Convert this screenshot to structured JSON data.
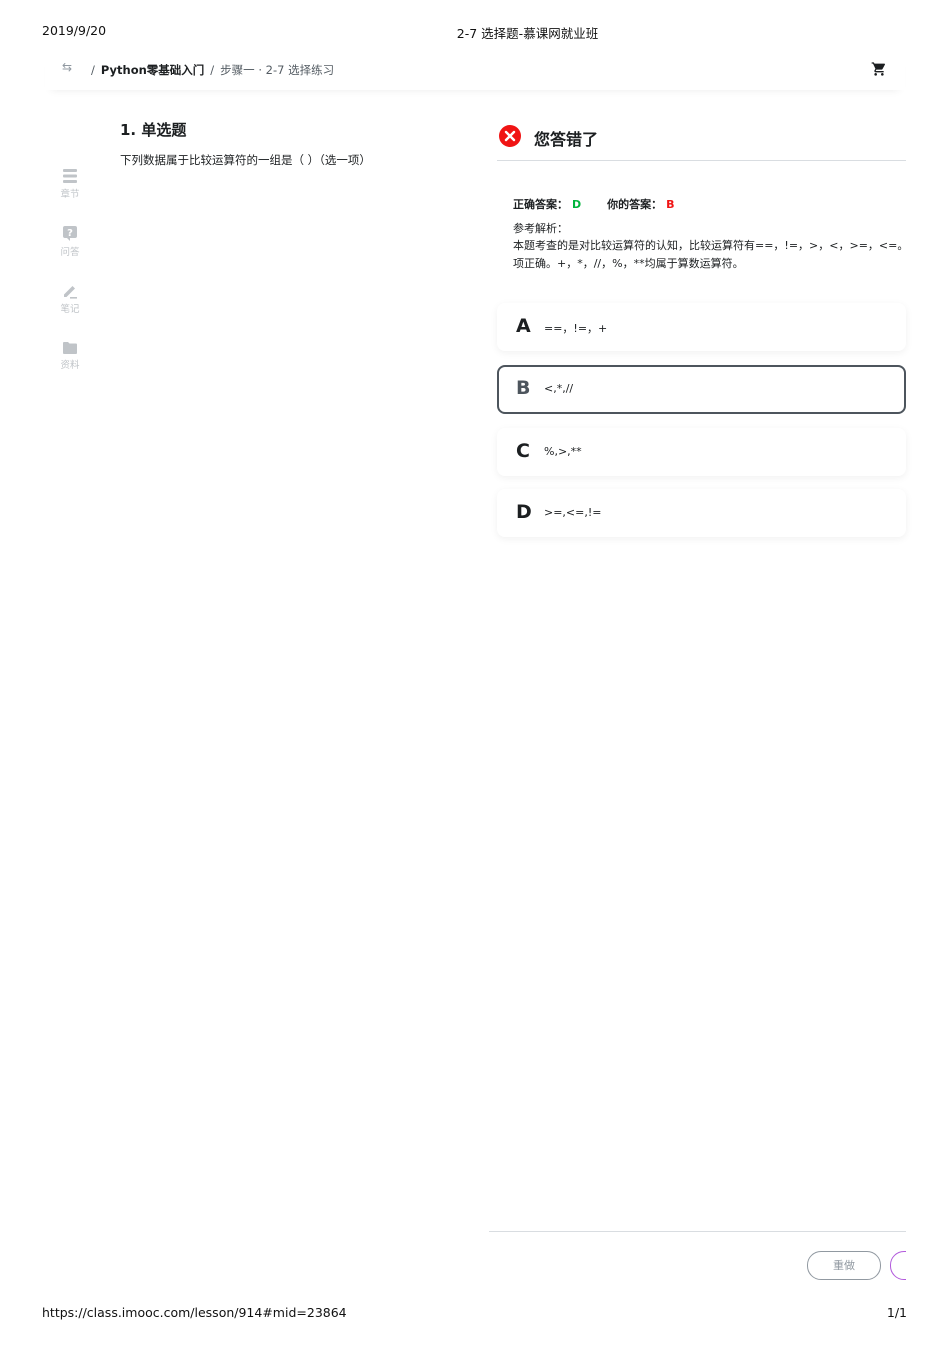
{
  "print_header": {
    "date": "2019/9/20",
    "title": "2-7 选择题-慕课网就业班"
  },
  "print_footer": {
    "url": "https://class.imooc.com/lesson/914#mid=23864",
    "page": "1/1"
  },
  "breadcrumb": {
    "back_icon": "switch-arrows-icon",
    "separator": "/",
    "course": "Python零基础入门",
    "lesson": "步骤一 · 2-7 选择练习",
    "cart_icon": "cart-icon"
  },
  "sidenav": {
    "items": [
      {
        "icon": "chapter-icon",
        "label": "章节"
      },
      {
        "icon": "question-icon",
        "label": "问答"
      },
      {
        "icon": "pencil-icon",
        "label": "笔记"
      },
      {
        "icon": "folder-icon",
        "label": "资料"
      }
    ],
    "icon_color": "#c0c4c8"
  },
  "question": {
    "title": "1. 单选题",
    "text": "下列数据属于比较运算符的一组是（ ）（选一项）"
  },
  "result": {
    "icon": "error-x-icon",
    "text": "您答错了",
    "correct_label": "正确答案：",
    "correct_value": "D",
    "mine_label": "你的答案：",
    "mine_value": "B",
    "explain_label": "参考解析：",
    "explain_text": "本题考查的是对比较运算符的认知，比较运算符有==，!=，>，<，>=，<=。\n项正确。+，*，//，%，**均属于算数运算符。"
  },
  "options": [
    {
      "letter": "A",
      "text": "==，!=，+"
    },
    {
      "letter": "B",
      "text": "<,*,//",
      "selected": true
    },
    {
      "letter": "C",
      "text": "%,>,**"
    },
    {
      "letter": "D",
      "text": ">=,<=,!="
    }
  ],
  "footer_actions": {
    "redo_label": "重做"
  },
  "colors": {
    "correct": "#00b43c",
    "wrong": "#f01414",
    "selected_border": "#4d555d",
    "next_button": "#b25adc"
  }
}
